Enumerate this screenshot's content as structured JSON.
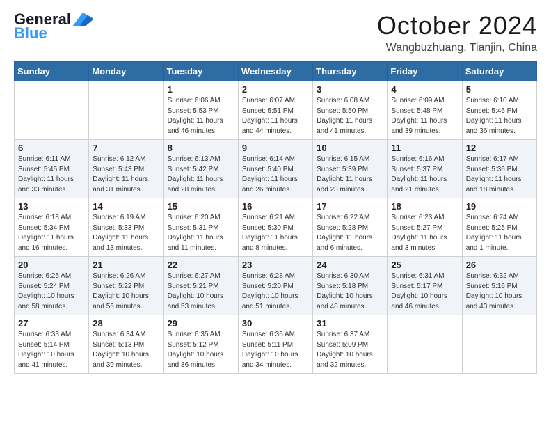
{
  "logo": {
    "line1": "General",
    "line2": "Blue"
  },
  "title": {
    "month_year": "October 2024",
    "location": "Wangbuzhuang, Tianjin, China"
  },
  "days_of_week": [
    "Sunday",
    "Monday",
    "Tuesday",
    "Wednesday",
    "Thursday",
    "Friday",
    "Saturday"
  ],
  "weeks": [
    [
      {
        "day": "",
        "sunrise": "",
        "sunset": "",
        "daylight": ""
      },
      {
        "day": "",
        "sunrise": "",
        "sunset": "",
        "daylight": ""
      },
      {
        "day": "1",
        "sunrise": "Sunrise: 6:06 AM",
        "sunset": "Sunset: 5:53 PM",
        "daylight": "Daylight: 11 hours and 46 minutes."
      },
      {
        "day": "2",
        "sunrise": "Sunrise: 6:07 AM",
        "sunset": "Sunset: 5:51 PM",
        "daylight": "Daylight: 11 hours and 44 minutes."
      },
      {
        "day": "3",
        "sunrise": "Sunrise: 6:08 AM",
        "sunset": "Sunset: 5:50 PM",
        "daylight": "Daylight: 11 hours and 41 minutes."
      },
      {
        "day": "4",
        "sunrise": "Sunrise: 6:09 AM",
        "sunset": "Sunset: 5:48 PM",
        "daylight": "Daylight: 11 hours and 39 minutes."
      },
      {
        "day": "5",
        "sunrise": "Sunrise: 6:10 AM",
        "sunset": "Sunset: 5:46 PM",
        "daylight": "Daylight: 11 hours and 36 minutes."
      }
    ],
    [
      {
        "day": "6",
        "sunrise": "Sunrise: 6:11 AM",
        "sunset": "Sunset: 5:45 PM",
        "daylight": "Daylight: 11 hours and 33 minutes."
      },
      {
        "day": "7",
        "sunrise": "Sunrise: 6:12 AM",
        "sunset": "Sunset: 5:43 PM",
        "daylight": "Daylight: 11 hours and 31 minutes."
      },
      {
        "day": "8",
        "sunrise": "Sunrise: 6:13 AM",
        "sunset": "Sunset: 5:42 PM",
        "daylight": "Daylight: 11 hours and 28 minutes."
      },
      {
        "day": "9",
        "sunrise": "Sunrise: 6:14 AM",
        "sunset": "Sunset: 5:40 PM",
        "daylight": "Daylight: 11 hours and 26 minutes."
      },
      {
        "day": "10",
        "sunrise": "Sunrise: 6:15 AM",
        "sunset": "Sunset: 5:39 PM",
        "daylight": "Daylight: 11 hours and 23 minutes."
      },
      {
        "day": "11",
        "sunrise": "Sunrise: 6:16 AM",
        "sunset": "Sunset: 5:37 PM",
        "daylight": "Daylight: 11 hours and 21 minutes."
      },
      {
        "day": "12",
        "sunrise": "Sunrise: 6:17 AM",
        "sunset": "Sunset: 5:36 PM",
        "daylight": "Daylight: 11 hours and 18 minutes."
      }
    ],
    [
      {
        "day": "13",
        "sunrise": "Sunrise: 6:18 AM",
        "sunset": "Sunset: 5:34 PM",
        "daylight": "Daylight: 11 hours and 16 minutes."
      },
      {
        "day": "14",
        "sunrise": "Sunrise: 6:19 AM",
        "sunset": "Sunset: 5:33 PM",
        "daylight": "Daylight: 11 hours and 13 minutes."
      },
      {
        "day": "15",
        "sunrise": "Sunrise: 6:20 AM",
        "sunset": "Sunset: 5:31 PM",
        "daylight": "Daylight: 11 hours and 11 minutes."
      },
      {
        "day": "16",
        "sunrise": "Sunrise: 6:21 AM",
        "sunset": "Sunset: 5:30 PM",
        "daylight": "Daylight: 11 hours and 8 minutes."
      },
      {
        "day": "17",
        "sunrise": "Sunrise: 6:22 AM",
        "sunset": "Sunset: 5:28 PM",
        "daylight": "Daylight: 11 hours and 6 minutes."
      },
      {
        "day": "18",
        "sunrise": "Sunrise: 6:23 AM",
        "sunset": "Sunset: 5:27 PM",
        "daylight": "Daylight: 11 hours and 3 minutes."
      },
      {
        "day": "19",
        "sunrise": "Sunrise: 6:24 AM",
        "sunset": "Sunset: 5:25 PM",
        "daylight": "Daylight: 11 hours and 1 minute."
      }
    ],
    [
      {
        "day": "20",
        "sunrise": "Sunrise: 6:25 AM",
        "sunset": "Sunset: 5:24 PM",
        "daylight": "Daylight: 10 hours and 58 minutes."
      },
      {
        "day": "21",
        "sunrise": "Sunrise: 6:26 AM",
        "sunset": "Sunset: 5:22 PM",
        "daylight": "Daylight: 10 hours and 56 minutes."
      },
      {
        "day": "22",
        "sunrise": "Sunrise: 6:27 AM",
        "sunset": "Sunset: 5:21 PM",
        "daylight": "Daylight: 10 hours and 53 minutes."
      },
      {
        "day": "23",
        "sunrise": "Sunrise: 6:28 AM",
        "sunset": "Sunset: 5:20 PM",
        "daylight": "Daylight: 10 hours and 51 minutes."
      },
      {
        "day": "24",
        "sunrise": "Sunrise: 6:30 AM",
        "sunset": "Sunset: 5:18 PM",
        "daylight": "Daylight: 10 hours and 48 minutes."
      },
      {
        "day": "25",
        "sunrise": "Sunrise: 6:31 AM",
        "sunset": "Sunset: 5:17 PM",
        "daylight": "Daylight: 10 hours and 46 minutes."
      },
      {
        "day": "26",
        "sunrise": "Sunrise: 6:32 AM",
        "sunset": "Sunset: 5:16 PM",
        "daylight": "Daylight: 10 hours and 43 minutes."
      }
    ],
    [
      {
        "day": "27",
        "sunrise": "Sunrise: 6:33 AM",
        "sunset": "Sunset: 5:14 PM",
        "daylight": "Daylight: 10 hours and 41 minutes."
      },
      {
        "day": "28",
        "sunrise": "Sunrise: 6:34 AM",
        "sunset": "Sunset: 5:13 PM",
        "daylight": "Daylight: 10 hours and 39 minutes."
      },
      {
        "day": "29",
        "sunrise": "Sunrise: 6:35 AM",
        "sunset": "Sunset: 5:12 PM",
        "daylight": "Daylight: 10 hours and 36 minutes."
      },
      {
        "day": "30",
        "sunrise": "Sunrise: 6:36 AM",
        "sunset": "Sunset: 5:11 PM",
        "daylight": "Daylight: 10 hours and 34 minutes."
      },
      {
        "day": "31",
        "sunrise": "Sunrise: 6:37 AM",
        "sunset": "Sunset: 5:09 PM",
        "daylight": "Daylight: 10 hours and 32 minutes."
      },
      {
        "day": "",
        "sunrise": "",
        "sunset": "",
        "daylight": ""
      },
      {
        "day": "",
        "sunrise": "",
        "sunset": "",
        "daylight": ""
      }
    ]
  ]
}
